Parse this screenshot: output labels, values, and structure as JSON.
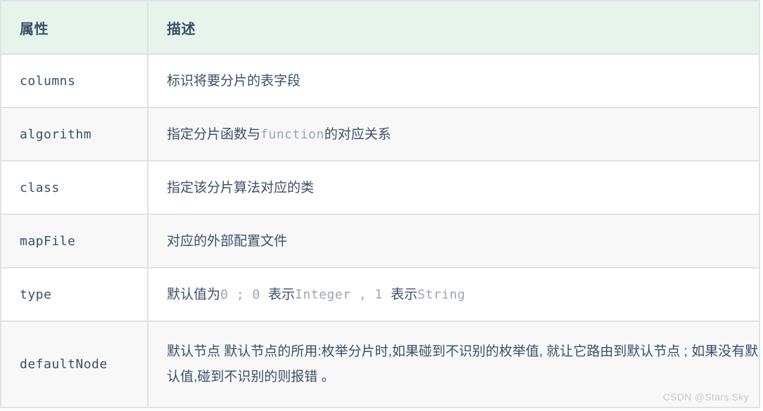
{
  "table": {
    "headers": {
      "attribute": "属性",
      "description": "描述"
    },
    "header_bg": "#e7f4ec",
    "border_color": "#dfe2e6",
    "text_color": "#3a5068",
    "code_color": "#9aa6b6",
    "row_alt_bg": "#f8f8f9",
    "rows": [
      {
        "attribute": "columns",
        "description_parts": [
          {
            "type": "text",
            "value": "标识将要分片的表字段"
          }
        ],
        "description_plain": "标识将要分片的表字段"
      },
      {
        "attribute": "algorithm",
        "description_parts": [
          {
            "type": "text",
            "value": "指定分片函数与"
          },
          {
            "type": "code",
            "value": "function"
          },
          {
            "type": "text",
            "value": "的对应关系"
          }
        ],
        "description_plain": "指定分片函数与function的对应关系"
      },
      {
        "attribute": "class",
        "description_parts": [
          {
            "type": "text",
            "value": "指定该分片算法对应的类"
          }
        ],
        "description_plain": "指定该分片算法对应的类"
      },
      {
        "attribute": "mapFile",
        "description_parts": [
          {
            "type": "text",
            "value": "对应的外部配置文件"
          }
        ],
        "description_plain": "对应的外部配置文件"
      },
      {
        "attribute": "type",
        "description_parts": [
          {
            "type": "text",
            "value": "默认值为"
          },
          {
            "type": "code",
            "value": "0 ; 0 "
          },
          {
            "type": "text",
            "value": "表示"
          },
          {
            "type": "code",
            "value": "Integer , 1 "
          },
          {
            "type": "text",
            "value": "表示"
          },
          {
            "type": "code",
            "value": "String"
          }
        ],
        "description_plain": "默认值为0 ; 0 表示Integer , 1 表示String"
      },
      {
        "attribute": "defaultNode",
        "description_parts": [
          {
            "type": "text",
            "value": "默认节点 默认节点的所用:枚举分片时,如果碰到不识别的枚举值, 就让它路由到默认节点 ; 如果没有默认值,碰到不识别的则报错 。"
          }
        ],
        "description_plain": "默认节点 默认节点的所用:枚举分片时,如果碰到不识别的枚举值, 就让它路由到默认节点 ; 如果没有默认值,碰到不识别的则报错 。"
      }
    ]
  },
  "watermark": {
    "text": "CSDN @Stars.Sky"
  }
}
